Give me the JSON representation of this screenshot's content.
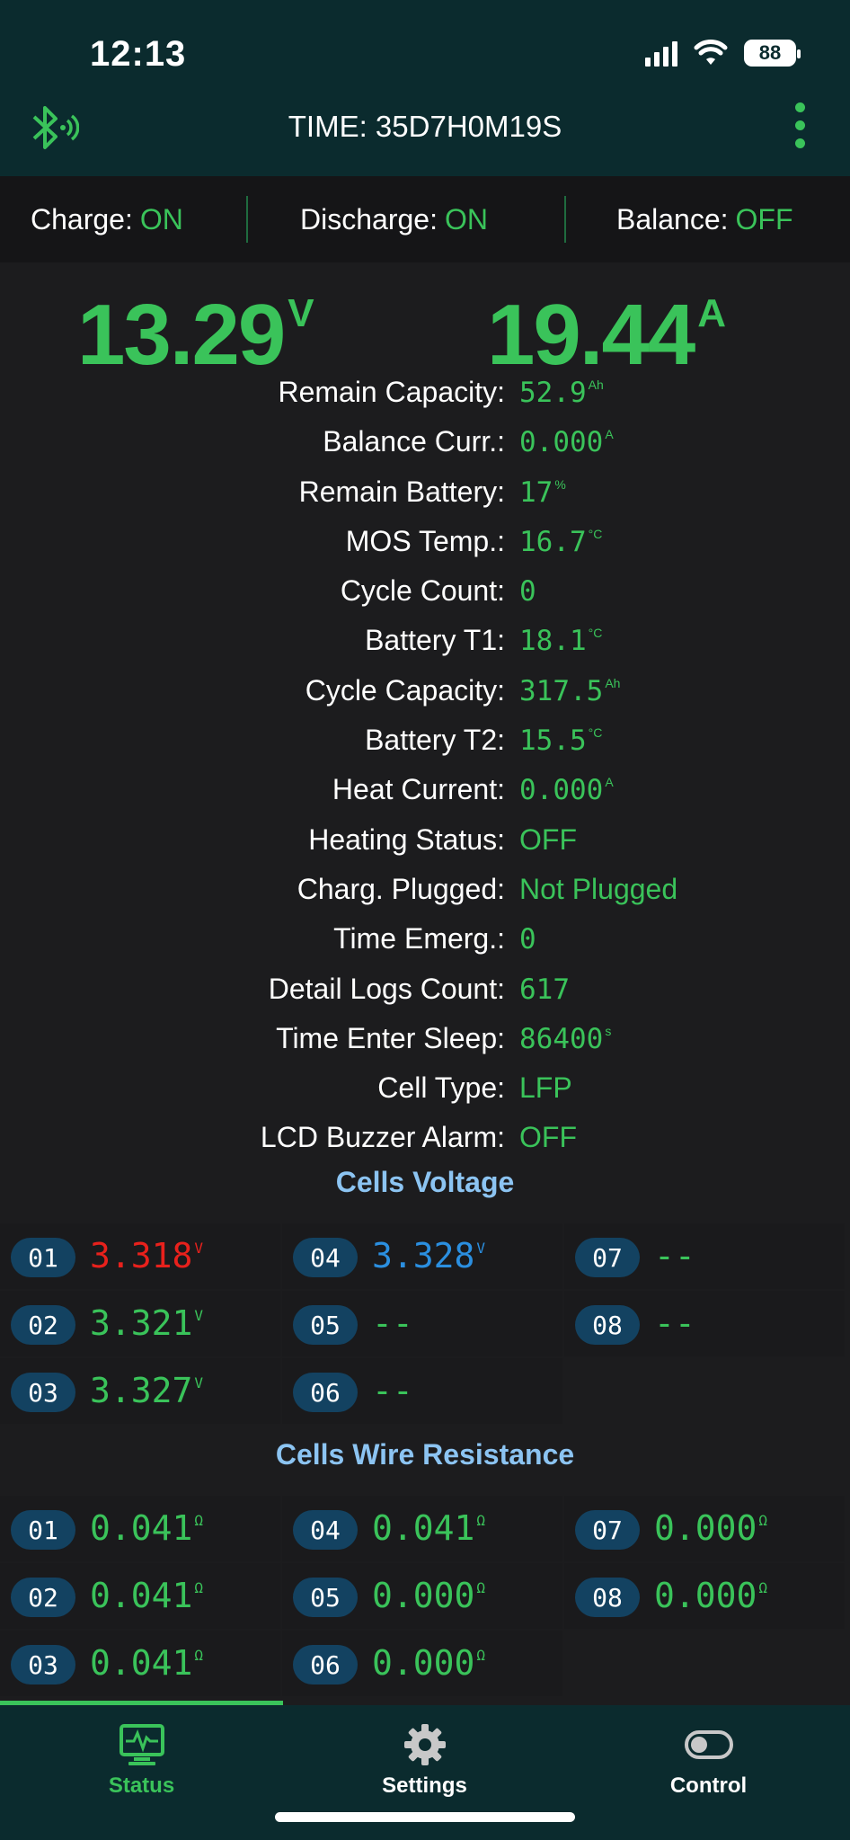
{
  "status_bar": {
    "time": "12:13",
    "battery": "88"
  },
  "header": {
    "title": "TIME: 35D7H0M19S"
  },
  "switches": [
    {
      "label": "Charge:",
      "value": "ON"
    },
    {
      "label": "Discharge:",
      "value": "ON"
    },
    {
      "label": "Balance:",
      "value": "OFF"
    }
  ],
  "main": {
    "voltage": "13.29",
    "voltage_unit": "V",
    "current": "19.44",
    "current_unit": "A"
  },
  "details": [
    {
      "label": "Remain Capacity:",
      "value": "52.9",
      "unit": "Ah",
      "mono": true
    },
    {
      "label": "Balance Curr.:",
      "value": "0.000",
      "unit": "A",
      "mono": true
    },
    {
      "label": "Remain Battery:",
      "value": "17",
      "unit": "%",
      "mono": true
    },
    {
      "label": "MOS Temp.:",
      "value": "16.7",
      "unit": "°C",
      "mono": true
    },
    {
      "label": "Cycle Count:",
      "value": "0",
      "unit": "",
      "mono": true
    },
    {
      "label": "Battery T1:",
      "value": "18.1",
      "unit": "°C",
      "mono": true
    },
    {
      "label": "Cycle Capacity:",
      "value": "317.5",
      "unit": "Ah",
      "mono": true
    },
    {
      "label": "Battery T2:",
      "value": "15.5",
      "unit": "°C",
      "mono": true
    },
    {
      "label": "Heat Current:",
      "value": "0.000",
      "unit": "A",
      "mono": true
    },
    {
      "label": "Heating Status:",
      "value": "OFF",
      "unit": "",
      "mono": false
    },
    {
      "label": "Charg. Plugged:",
      "value": "Not Plugged",
      "unit": "",
      "mono": false
    },
    {
      "label": "Time Emerg.:",
      "value": "0",
      "unit": "",
      "mono": true
    },
    {
      "label": "Detail Logs Count:",
      "value": "617",
      "unit": "",
      "mono": true
    },
    {
      "label": "Time Enter Sleep:",
      "value": "86400",
      "unit": "s",
      "mono": true
    },
    {
      "label": "Cell Type:",
      "value": "LFP",
      "unit": "",
      "mono": false
    },
    {
      "label": "LCD Buzzer Alarm:",
      "value": "OFF",
      "unit": "",
      "mono": false
    }
  ],
  "cells_voltage": {
    "title": "Cells Voltage",
    "cells": [
      {
        "id": "01",
        "value": "3.318",
        "unit": "V",
        "color": "#e8211c"
      },
      {
        "id": "02",
        "value": "3.321",
        "unit": "V",
        "color": "#3ac35a"
      },
      {
        "id": "03",
        "value": "3.327",
        "unit": "V",
        "color": "#3ac35a"
      },
      {
        "id": "04",
        "value": "3.328",
        "unit": "V",
        "color": "#2b8fe0"
      },
      {
        "id": "05",
        "value": "--",
        "unit": "",
        "color": "#3ac35a"
      },
      {
        "id": "06",
        "value": "--",
        "unit": "",
        "color": "#3ac35a"
      },
      {
        "id": "07",
        "value": "--",
        "unit": "",
        "color": "#3ac35a"
      },
      {
        "id": "08",
        "value": "--",
        "unit": "",
        "color": "#3ac35a"
      }
    ]
  },
  "cells_resistance": {
    "title": "Cells Wire Resistance",
    "cells": [
      {
        "id": "01",
        "value": "0.041",
        "unit": "Ω",
        "color": "#3ac35a"
      },
      {
        "id": "02",
        "value": "0.041",
        "unit": "Ω",
        "color": "#3ac35a"
      },
      {
        "id": "03",
        "value": "0.041",
        "unit": "Ω",
        "color": "#3ac35a"
      },
      {
        "id": "04",
        "value": "0.041",
        "unit": "Ω",
        "color": "#3ac35a"
      },
      {
        "id": "05",
        "value": "0.000",
        "unit": "Ω",
        "color": "#3ac35a"
      },
      {
        "id": "06",
        "value": "0.000",
        "unit": "Ω",
        "color": "#3ac35a"
      },
      {
        "id": "07",
        "value": "0.000",
        "unit": "Ω",
        "color": "#3ac35a"
      },
      {
        "id": "08",
        "value": "0.000",
        "unit": "Ω",
        "color": "#3ac35a"
      }
    ]
  },
  "tabs": [
    {
      "label": "Status",
      "icon": "monitor-pulse-icon",
      "active": true
    },
    {
      "label": "Settings",
      "icon": "gear-icon",
      "active": false
    },
    {
      "label": "Control",
      "icon": "toggle-icon",
      "active": false
    }
  ],
  "colors": {
    "accent": "#3ac35a",
    "header_bg": "#0b2b2e",
    "section_title": "#8cc4f2",
    "pill_bg": "#134261"
  }
}
